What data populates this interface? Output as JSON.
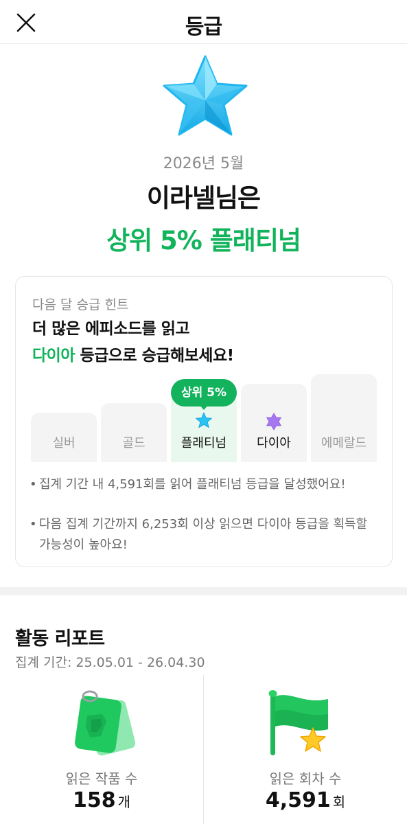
{
  "header": {
    "title": "등급",
    "close_icon": "close-icon"
  },
  "hero": {
    "icon": "star-icon",
    "period": "2026년 5월",
    "user_line": "이라넬님은",
    "grade_line": "상위 5% 플래티넘",
    "accent_color": "#11b35b"
  },
  "hint": {
    "label": "다음 달 승급 힌트",
    "headline_1": "더 많은 에피소드를 읽고",
    "headline_2_accent": "다이아",
    "headline_2_rest": " 등급으로 승급해보세요!",
    "badge": "상위 5%",
    "tiers": [
      {
        "label": "실버"
      },
      {
        "label": "골드"
      },
      {
        "label": "플래티넘",
        "icon": "star-icon"
      },
      {
        "label": "다이아",
        "icon": "hexagram-icon"
      },
      {
        "label": "에메랄드"
      }
    ],
    "notes": [
      "집계 기간 내 4,591회를 읽어 플래티넘 등급을 달성했어요!",
      "다음 집계 기간까지 6,253회 이상 읽으면 다이아 등급을 획득할 가능성이 높아요!"
    ],
    "bullet": "•"
  },
  "report": {
    "title": "활동 리포트",
    "period": "집계 기간: 25.05.01 - 26.04.30",
    "stats": [
      {
        "icon": "book-tag-icon",
        "label": "읽은 작품 수",
        "value": "158",
        "unit": "개"
      },
      {
        "icon": "flag-star-icon",
        "label": "읽은 회차 수",
        "value": "4,591",
        "unit": "회"
      }
    ]
  }
}
